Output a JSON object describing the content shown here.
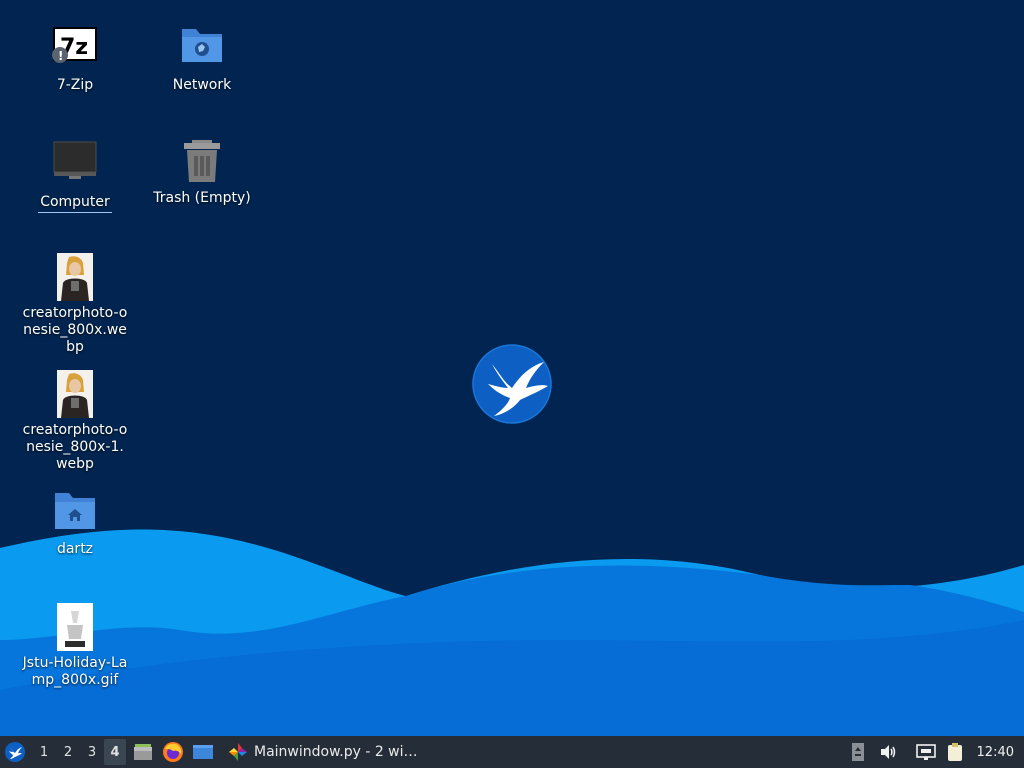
{
  "desktop": {
    "icons": [
      {
        "label": "7-Zip",
        "icon": "7zip-archive-icon"
      },
      {
        "label": "Network",
        "icon": "network-folder-icon"
      },
      {
        "label": "Computer",
        "icon": "computer-monitor-icon"
      },
      {
        "label": "Trash (Empty)",
        "icon": "trash-icon"
      },
      {
        "label": "creatorphoto-onesie_800x.webp",
        "icon": "image-thumbnail-icon"
      },
      {
        "label": "creatorphoto-onesie_800x-1.webp",
        "icon": "image-thumbnail-icon"
      },
      {
        "label": "dartz",
        "icon": "home-folder-icon"
      },
      {
        "label": "Jstu-Holiday-Lamp_800x.gif",
        "icon": "image-thumbnail-icon"
      }
    ],
    "wallpaper_logo": "hummingbird-logo-icon",
    "colors": {
      "background": "#012550",
      "wave_light": "#0a9bf0",
      "wave_dark": "#0566cf",
      "logo": "#0d5fc4"
    }
  },
  "taskbar": {
    "workspaces": [
      "1",
      "2",
      "3",
      "4"
    ],
    "active_workspace": "4",
    "launchers": [
      "file-manager-icon",
      "firefox-icon",
      "show-desktop-icon"
    ],
    "task_title": "Mainwindow.py - 2 wi…",
    "tray": [
      "notification-icon",
      "volume-icon",
      "network-icon",
      "clipboard-icon"
    ],
    "clock": "12:40",
    "colors": {
      "panel": "#252e38"
    }
  }
}
